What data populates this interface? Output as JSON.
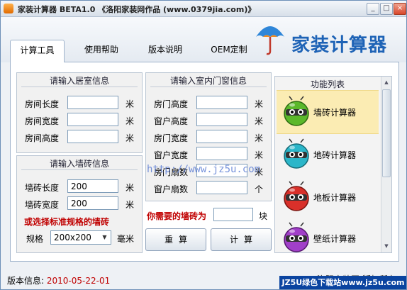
{
  "window": {
    "title": "家装计算器 BETA1.0  《洛阳家装网作品 (www.0379jia.com)》",
    "minimize": "_",
    "maximize": "□",
    "close": "×"
  },
  "brand": {
    "name": "家装计算器"
  },
  "tabs": [
    {
      "label": "计算工具"
    },
    {
      "label": "使用帮助"
    },
    {
      "label": "版本说明"
    },
    {
      "label": "OEM定制"
    }
  ],
  "room": {
    "title": "请输入居室信息",
    "fields": [
      {
        "label": "房间长度",
        "value": "",
        "unit": "米"
      },
      {
        "label": "房间宽度",
        "value": "",
        "unit": "米"
      },
      {
        "label": "房间高度",
        "value": "",
        "unit": "米"
      }
    ]
  },
  "tile": {
    "title": "请输入墙砖信息",
    "fields": [
      {
        "label": "墙砖长度",
        "value": "200",
        "unit": "米"
      },
      {
        "label": "墙砖宽度",
        "value": "200",
        "unit": "米"
      }
    ],
    "hint": "或选择标准规格的墙砖",
    "spec_label": "规格",
    "spec_value": "200x200",
    "spec_unit": "毫米"
  },
  "doors": {
    "title": "请输入室内门窗信息",
    "fields": [
      {
        "label": "房门高度",
        "value": "",
        "unit": "米"
      },
      {
        "label": "窗户高度",
        "value": "",
        "unit": "米"
      },
      {
        "label": "房门宽度",
        "value": "",
        "unit": "米"
      },
      {
        "label": "窗户宽度",
        "value": "",
        "unit": "米"
      },
      {
        "label": "房门扇数",
        "value": "",
        "unit": "米"
      },
      {
        "label": "窗户扇数",
        "value": "",
        "unit": "个"
      }
    ]
  },
  "result": {
    "label": "你需要的墙砖为",
    "value": "",
    "unit": "块"
  },
  "buttons": {
    "reset": "重算",
    "calc": "计算"
  },
  "watermark": "http://www.jz5u.com",
  "functions": {
    "title": "功能列表",
    "items": [
      {
        "label": "墙砖计算器",
        "color": "#5bb82a"
      },
      {
        "label": "地砖计算器",
        "color": "#2bb6c9"
      },
      {
        "label": "地板计算器",
        "color": "#d9302a"
      },
      {
        "label": "壁纸计算器",
        "color": "#a13fc9"
      }
    ]
  },
  "status": {
    "label": "版本信息:",
    "value": "2010-05-22-01",
    "copyright": "洛阳家装网 版权所有"
  },
  "badge": "JZ5U绿色下载站www.jz5u.com"
}
